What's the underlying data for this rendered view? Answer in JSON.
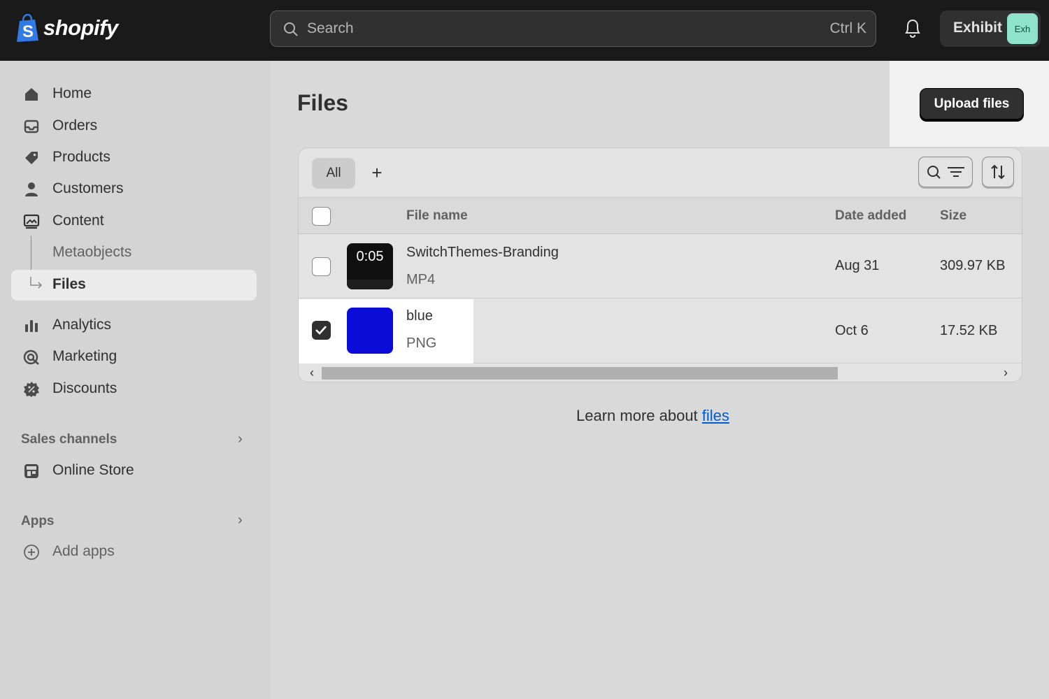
{
  "topbar": {
    "brand": "shopify",
    "search_placeholder": "Search",
    "search_shortcut": "Ctrl K",
    "store_name": "Exhibit",
    "store_avatar": "Exh",
    "icons": {
      "search": "search-icon",
      "notifications": "bell-icon",
      "logo": "shopify-bag-icon"
    }
  },
  "sidebar": {
    "items": [
      {
        "label": "Home",
        "icon": "home-icon"
      },
      {
        "label": "Orders",
        "icon": "inbox-icon"
      },
      {
        "label": "Products",
        "icon": "tag-icon"
      },
      {
        "label": "Customers",
        "icon": "person-icon"
      },
      {
        "label": "Content",
        "icon": "image-icon"
      },
      {
        "label": "Metaobjects"
      },
      {
        "label": "Files",
        "active": true
      },
      {
        "label": "Analytics",
        "icon": "bar-chart-icon"
      },
      {
        "label": "Marketing",
        "icon": "target-icon"
      },
      {
        "label": "Discounts",
        "icon": "discount-icon"
      }
    ],
    "sales_channels": {
      "header": "Sales channels",
      "items": [
        {
          "label": "Online Store",
          "icon": "store-icon"
        }
      ]
    },
    "apps": {
      "header": "Apps",
      "items": [
        {
          "label": "Add apps",
          "icon": "plus-circle-icon"
        }
      ]
    }
  },
  "main": {
    "title": "Files",
    "upload_label": "Upload files",
    "tabs": [
      {
        "label": "All",
        "selected": true
      },
      {
        "label": "+"
      }
    ],
    "columns": {
      "name": "File name",
      "date": "Date added",
      "size": "Size"
    },
    "rows": [
      {
        "thumb_label": "0:05",
        "name": "SwitchThemes-Branding",
        "type": "MP4",
        "date": "Aug 31",
        "size": "309.97 KB",
        "checked": false
      },
      {
        "name": "blue",
        "type": "PNG",
        "date": "Oct 6",
        "size": "17.52 KB",
        "checked": true,
        "thumb_color": "#0c0cd8"
      }
    ],
    "learn_prefix": "Learn more about",
    "learn_link": "files"
  },
  "colors": {
    "topbar": "#1a1a1a",
    "accent_link": "#005bd3",
    "primary_button": "#303030",
    "avatar": "#8ee3c8"
  }
}
